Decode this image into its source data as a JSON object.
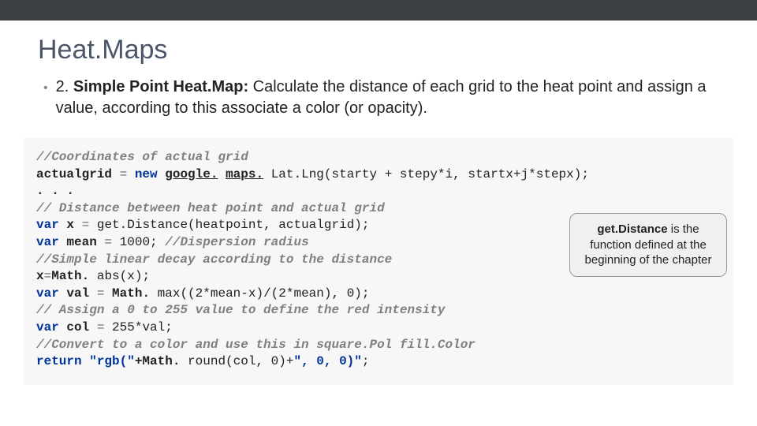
{
  "header": {
    "title": "Heat.Maps"
  },
  "bullet": {
    "lead_number": "2.",
    "lead_bold": "Simple Point Heat.Map:",
    "rest": "Calculate the distance of each grid to the heat point and assign a value, according to this associate a color (or opacity)."
  },
  "code": {
    "l1": "//Coordinates of actual grid",
    "l2a": "actualgrid",
    "l2b": " = ",
    "l2c": "new",
    "l2d": " ",
    "l2e": "google.",
    "l2f": " ",
    "l2g": "maps.",
    "l2h": " Lat.Lng(starty + stepy*i, startx+j*stepx);",
    "l3": ". . .",
    "l4": "// Distance between heat point and actual grid",
    "l5a": "var",
    "l5b": " x ",
    "l5c": "=",
    "l5d": " get.Distance(heatpoint, actualgrid);",
    "l6a": "var",
    "l6b": " mean ",
    "l6c": "=",
    "l6d": " 1000; ",
    "l6e": "//Dispersion radius",
    "l7": "//Simple linear decay according to the distance",
    "l8a": "x",
    "l8b": "=",
    "l8c": "Math.",
    "l8d": " abs(x);",
    "l9a": "var",
    "l9b": " val ",
    "l9c": "=",
    "l9d": " Math.",
    "l9e": " max((2*mean-x)/(2*mean), 0);",
    "l10": "// Assign a 0 to 255 value to define the red intensity",
    "l11a": "var",
    "l11b": " col ",
    "l11c": "=",
    "l11d": " 255*val;",
    "l12": "//Convert to a color and use this in square.Pol fill.Color",
    "l13a": "return",
    "l13b": " \"rgb(\"",
    "l13c": "+Math.",
    "l13d": " round(col, 0)+",
    "l13e": "\", 0, 0)\"",
    "l13f": ";"
  },
  "callout": {
    "bold": "get.Distance",
    "rest": " is the function defined at the beginning of the chapter"
  }
}
